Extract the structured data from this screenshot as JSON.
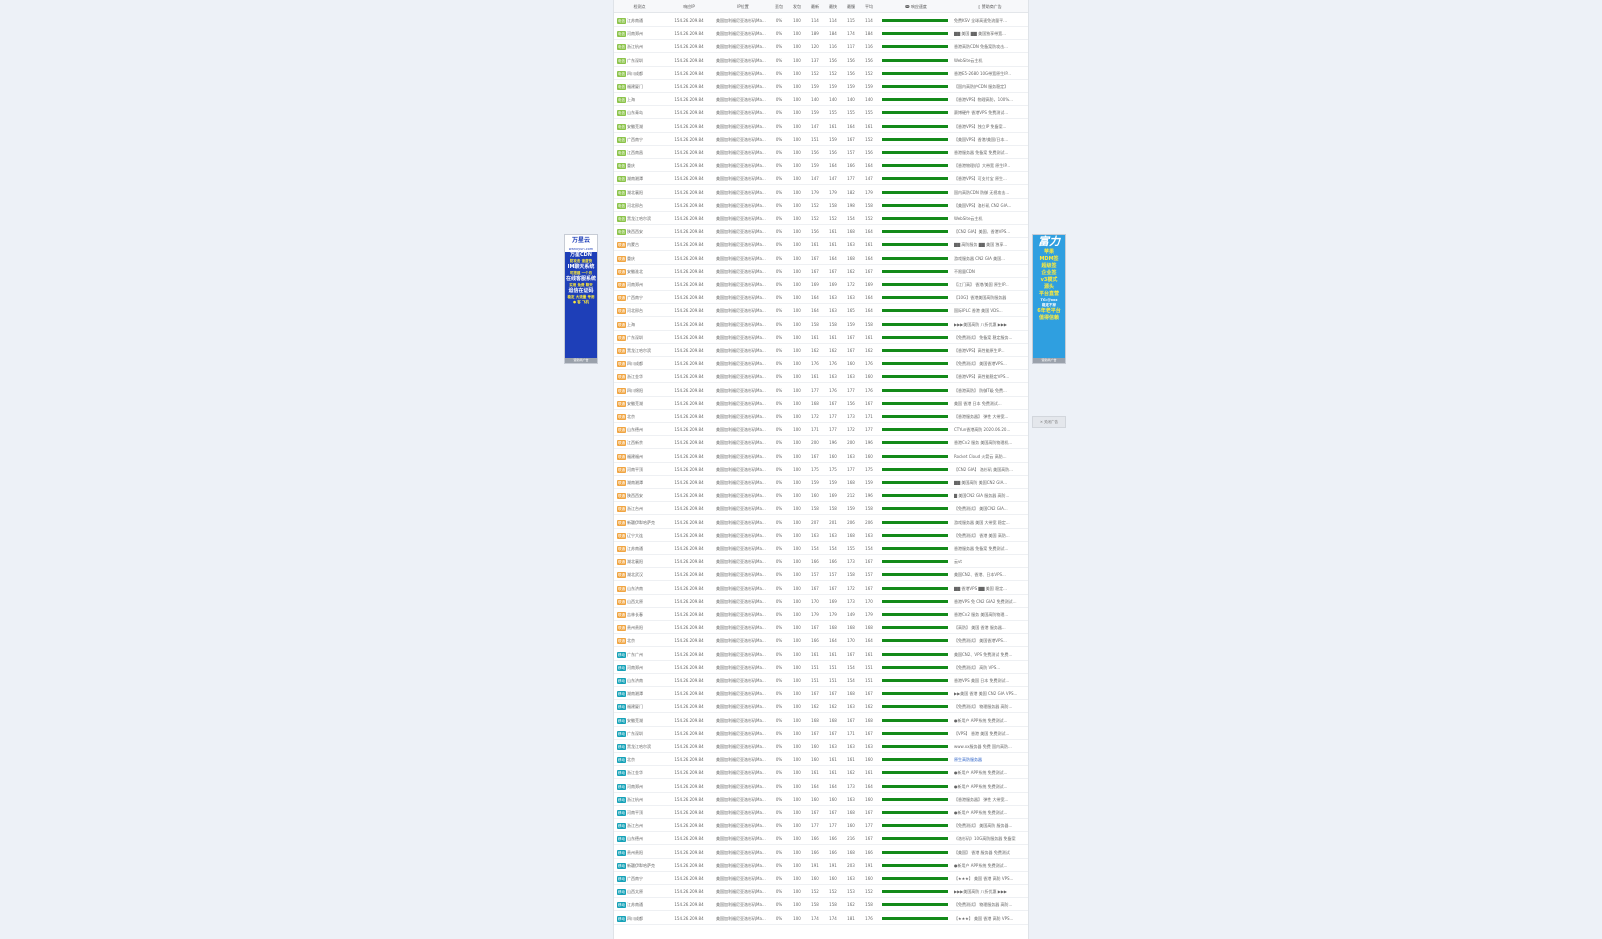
{
  "headers": {
    "node": "检测点",
    "ip": "响应IP",
    "pos": "IP位置",
    "loss": "丢包",
    "sent": "发包",
    "last": "最新",
    "min": "最快",
    "max": "最慢",
    "avg": "平均",
    "chart": "ↈ 响应速度",
    "ad": "▯ 赞助商广告"
  },
  "ip_value": "154.26.209.84",
  "pos_value": "美国加利福尼亚洛杉矶Ma...",
  "loss_value": "0%",
  "sent_value": "100",
  "badges": {
    "dx": "电信",
    "lt": "联通",
    "yd": "移动"
  },
  "badge_colors": {
    "dx": "#8bc34a",
    "lt": "#f0a542",
    "yd": "#17a2b8"
  },
  "rows": [
    {
      "isp": "dx",
      "node": "江苏南通",
      "last": "114",
      "min": "114",
      "max": "115",
      "avg": "114",
      "ad": "免费KSV 全球高速免流量平..."
    },
    {
      "isp": "dx",
      "node": "河南郑州",
      "last": "189",
      "min": "184",
      "max": "174",
      "avg": "184",
      "ad": "▇▇ 美国 ▇▇ 美国独享带宽..."
    },
    {
      "isp": "dx",
      "node": "浙江杭州",
      "last": "120",
      "min": "116",
      "max": "117",
      "avg": "116",
      "ad": "香港高防CDN 免备案防攻击..."
    },
    {
      "isp": "dx",
      "node": "广东深圳",
      "last": "137",
      "min": "156",
      "max": "156",
      "avg": "156",
      "ad": "WebSite云主机"
    },
    {
      "isp": "dx",
      "node": "四川成都",
      "last": "152",
      "min": "152",
      "max": "156",
      "avg": "152",
      "ad": "香港E5-2680 10G带宽原生IP..."
    },
    {
      "isp": "dx",
      "node": "福建厦门",
      "last": "159",
      "min": "159",
      "max": "159",
      "avg": "159",
      "ad": "【国内高防护CDN 服务稳定】"
    },
    {
      "isp": "dx",
      "node": "上海",
      "last": "140",
      "min": "140",
      "max": "140",
      "avg": "140",
      "ad": "【香港VPS】物理高防，100%..."
    },
    {
      "isp": "dx",
      "node": "山东青岛",
      "last": "159",
      "min": "155",
      "max": "155",
      "avg": "155",
      "ad": "赛博硬件 香港VPS 免费测试..."
    },
    {
      "isp": "dx",
      "node": "安徽芜湖",
      "last": "147",
      "min": "161",
      "max": "164",
      "avg": "161",
      "ad": "【香港VPS】独立IP 免备案..."
    },
    {
      "isp": "dx",
      "node": "广西南宁",
      "last": "151",
      "min": "159",
      "max": "167",
      "avg": "152",
      "ad": "【美国VPS】香港/美国/日本..."
    },
    {
      "isp": "dx",
      "node": "江西南昌",
      "last": "156",
      "min": "156",
      "max": "157",
      "avg": "156",
      "ad": "香港服务器 免备案 免费测试..."
    },
    {
      "isp": "dx",
      "node": "重庆",
      "last": "159",
      "min": "164",
      "max": "166",
      "avg": "164",
      "ad": "【香港物理机】大带宽 原生IP..."
    },
    {
      "isp": "dx",
      "node": "湖南湘潭",
      "last": "147",
      "min": "147",
      "max": "177",
      "avg": "147",
      "ad": "【香港VPS】可支付宝 原生..."
    },
    {
      "isp": "dx",
      "node": "湖北襄阳",
      "last": "179",
      "min": "179",
      "max": "182",
      "avg": "179",
      "ad": "国内高防CDN 防御 无视攻击..."
    },
    {
      "isp": "dx",
      "node": "河北邢台",
      "last": "152",
      "min": "158",
      "max": "198",
      "avg": "158",
      "ad": "【美国VPS】洛杉矶 CN2 GIA..."
    },
    {
      "isp": "dx",
      "node": "黑龙江哈尔滨",
      "last": "152",
      "min": "152",
      "max": "154",
      "avg": "152",
      "ad": "WebSite云主机"
    },
    {
      "isp": "dx",
      "node": "陕西西安",
      "last": "156",
      "min": "161",
      "max": "168",
      "avg": "164",
      "ad": "【CN2 GIA】美国、香港VPS..."
    },
    {
      "isp": "lt",
      "node": "内蒙古",
      "last": "161",
      "min": "161",
      "max": "163",
      "avg": "161",
      "ad": "▇▇ 高防服务 ▇▇ 美国 独享..."
    },
    {
      "isp": "lt",
      "node": "重庆",
      "last": "167",
      "min": "164",
      "max": "168",
      "avg": "164",
      "ad": "游戏服务器 CN2 GIA 美国..."
    },
    {
      "isp": "lt",
      "node": "安徽淮北",
      "last": "167",
      "min": "167",
      "max": "162",
      "avg": "167",
      "ad": "不限量CDN"
    },
    {
      "isp": "lt",
      "node": "河南郑州",
      "last": "169",
      "min": "169",
      "max": "172",
      "avg": "169",
      "ad": "【江门高】 香港/美国 原生IP..."
    },
    {
      "isp": "lt",
      "node": "广西南宁",
      "last": "164",
      "min": "163",
      "max": "163",
      "avg": "164",
      "ad": "【10G】香港美国高防服务器"
    },
    {
      "isp": "lt",
      "node": "河北邢台",
      "last": "164",
      "min": "163",
      "max": "165",
      "avg": "164",
      "ad": "国际IPLC 香港 美国 VDS..."
    },
    {
      "isp": "lt",
      "node": "上海",
      "last": "158",
      "min": "158",
      "max": "159",
      "avg": "158",
      "ad": "▶▶▶美国高防 八折优惠 ▶▶▶"
    },
    {
      "isp": "lt",
      "node": "广东深圳",
      "last": "161",
      "min": "161",
      "max": "167",
      "avg": "161",
      "ad": "【免费测试】 免备案 稳定服务..."
    },
    {
      "isp": "lt",
      "node": "黑龙江哈尔滨",
      "last": "162",
      "min": "162",
      "max": "167",
      "avg": "162",
      "ad": "【香港VPS】高性能原生IP..."
    },
    {
      "isp": "lt",
      "node": "四川成都",
      "last": "176",
      "min": "176",
      "max": "160",
      "avg": "176",
      "ad": "【免费测试】 美国香港VPS..."
    },
    {
      "isp": "lt",
      "node": "浙江金华",
      "last": "161",
      "min": "163",
      "max": "163",
      "avg": "160",
      "ad": "【香港VPS】高性能稳定VPS..."
    },
    {
      "isp": "lt",
      "node": "四川绵阳",
      "last": "177",
      "min": "176",
      "max": "177",
      "avg": "176",
      "ad": "【香港高防】 防御T级 免费..."
    },
    {
      "isp": "lt",
      "node": "安徽芜湖",
      "last": "168",
      "min": "167",
      "max": "156",
      "avg": "167",
      "ad": "美国 香港 日本 免费测试..."
    },
    {
      "isp": "lt",
      "node": "北京",
      "last": "172",
      "min": "177",
      "max": "173",
      "avg": "171",
      "ad": "【香港服务器】 弹性 大带宽..."
    },
    {
      "isp": "lt",
      "node": "山东德州",
      "last": "171",
      "min": "177",
      "max": "172",
      "avg": "177",
      "ad": "CTYun香港高防 2020.06.20..."
    },
    {
      "isp": "lt",
      "node": "江西新余",
      "last": "200",
      "min": "196",
      "max": "200",
      "avg": "196",
      "ad": "香港Cn2 服务 美国高防物理机..."
    },
    {
      "isp": "lt",
      "node": "福建福州",
      "last": "167",
      "min": "160",
      "max": "163",
      "avg": "160",
      "ad": "Rocket Cloud 火箭云 高防..."
    },
    {
      "isp": "lt",
      "node": "河南平顶",
      "last": "175",
      "min": "175",
      "max": "177",
      "avg": "175",
      "ad": "【CN2 GIA】 洛杉矶 美国高防..."
    },
    {
      "isp": "lt",
      "node": "湖南湘潭",
      "last": "159",
      "min": "159",
      "max": "168",
      "avg": "159",
      "ad": "▇▇ 美国高防 美国CN2 GIA..."
    },
    {
      "isp": "lt",
      "node": "陕西西安",
      "last": "160",
      "min": "169",
      "max": "212",
      "avg": "196",
      "ad": "▇ 美国CN2 GIA 服务器 高防..."
    },
    {
      "isp": "lt",
      "node": "浙江台州",
      "last": "158",
      "min": "158",
      "max": "159",
      "avg": "158",
      "ad": "【免费测试】 美国CN2 GIA..."
    },
    {
      "isp": "lt",
      "node": "新疆伊犁哈萨克",
      "last": "207",
      "min": "201",
      "max": "206",
      "avg": "206",
      "ad": "游戏服务器 美国 大带宽 稳定..."
    },
    {
      "isp": "lt",
      "node": "辽宁大连",
      "last": "163",
      "min": "163",
      "max": "168",
      "avg": "163",
      "ad": "【免费测试】 香港 美国 高防..."
    },
    {
      "isp": "lt",
      "node": "江苏南通",
      "last": "154",
      "min": "154",
      "max": "155",
      "avg": "154",
      "ad": "香港服务器 免备案 免费测试..."
    },
    {
      "isp": "lt",
      "node": "湖北襄阳",
      "last": "166",
      "min": "166",
      "max": "173",
      "avg": "167",
      "ad": "云vt"
    },
    {
      "isp": "lt",
      "node": "湖北武汉",
      "last": "157",
      "min": "157",
      "max": "158",
      "avg": "157",
      "ad": "美国CN2、香港、日本VPS..."
    },
    {
      "isp": "lt",
      "node": "山东济南",
      "last": "167",
      "min": "167",
      "max": "172",
      "avg": "167",
      "ad": "▇▇ 香港VPS ▇▇ 美国 稳定..."
    },
    {
      "isp": "lt",
      "node": "山西太原",
      "last": "170",
      "min": "169",
      "max": "173",
      "avg": "170",
      "ad": "香港VPS 免 CN2 GIA2 免费测试..."
    },
    {
      "isp": "lt",
      "node": "吉林长春",
      "last": "179",
      "min": "179",
      "max": "149",
      "avg": "179",
      "ad": "香港Cn2 服务 美国高防物理..."
    },
    {
      "isp": "lt",
      "node": "贵州贵阳",
      "last": "167",
      "min": "168",
      "max": "168",
      "avg": "168",
      "ad": "【高防】 美国 香港 服务器..."
    },
    {
      "isp": "lt",
      "node": "北京",
      "last": "166",
      "min": "164",
      "max": "170",
      "avg": "164",
      "ad": "【免费测试】 美国香港VPS..."
    },
    {
      "isp": "yd",
      "node": "广东广州",
      "last": "161",
      "min": "161",
      "max": "167",
      "avg": "161",
      "ad": "美国CN2、VPS 免费测试 免费..."
    },
    {
      "isp": "yd",
      "node": "河南郑州",
      "last": "151",
      "min": "151",
      "max": "154",
      "avg": "151",
      "ad": "【免费测试】 高防 VPS..."
    },
    {
      "isp": "yd",
      "node": "山东济南",
      "last": "151",
      "min": "151",
      "max": "154",
      "avg": "151",
      "ad": "香港VPS 美国 日本 免费测试..."
    },
    {
      "isp": "yd",
      "node": "湖南湘潭",
      "last": "167",
      "min": "167",
      "max": "168",
      "avg": "167",
      "ad": "▶▶美国 香港 美国 CN2 GIA VPS..."
    },
    {
      "isp": "yd",
      "node": "福建厦门",
      "last": "162",
      "min": "162",
      "max": "163",
      "avg": "162",
      "ad": "【免费测试】 物理服务器 高防..."
    },
    {
      "isp": "yd",
      "node": "安徽芜湖",
      "last": "168",
      "min": "168",
      "max": "167",
      "avg": "168",
      "ad": "●新用户 APP系统 免费测试..."
    },
    {
      "isp": "yd",
      "node": "广东深圳",
      "last": "167",
      "min": "167",
      "max": "171",
      "avg": "167",
      "ad": "【VPS】 香港 美国 免费测试..."
    },
    {
      "isp": "yd",
      "node": "黑龙江哈尔滨",
      "last": "160",
      "min": "163",
      "max": "163",
      "avg": "163",
      "ad": "www.xx服务器 免费 国内高防..."
    },
    {
      "isp": "yd",
      "node": "北京",
      "last": "160",
      "min": "161",
      "max": "161",
      "avg": "160",
      "ad": "原生高防服务器",
      "link": true
    },
    {
      "isp": "yd",
      "node": "浙江金华",
      "last": "161",
      "min": "161",
      "max": "162",
      "avg": "161",
      "ad": "●新用户 APP系统 免费测试..."
    },
    {
      "isp": "yd",
      "node": "河南郑州",
      "last": "164",
      "min": "164",
      "max": "173",
      "avg": "164",
      "ad": "●新用户 APP系统 免费测试..."
    },
    {
      "isp": "yd",
      "node": "浙江杭州",
      "last": "160",
      "min": "160",
      "max": "163",
      "avg": "160",
      "ad": "【香港服务器】 弹性 大带宽..."
    },
    {
      "isp": "yd",
      "node": "河南平顶",
      "last": "167",
      "min": "167",
      "max": "168",
      "avg": "167",
      "ad": "●新用户 APP系统 免费测试..."
    },
    {
      "isp": "yd",
      "node": "浙江台州",
      "last": "177",
      "min": "177",
      "max": "160",
      "avg": "177",
      "ad": "【免费测试】 美国高防 服务器..."
    },
    {
      "isp": "yd",
      "node": "山东德州",
      "last": "166",
      "min": "166",
      "max": "216",
      "avg": "167",
      "ad": "《洛杉矶》10G高防服务器 免备案"
    },
    {
      "isp": "yd",
      "node": "贵州贵阳",
      "last": "166",
      "min": "166",
      "max": "168",
      "avg": "166",
      "ad": "【美国】 香港 服务器 免费测试"
    },
    {
      "isp": "yd",
      "node": "新疆伊犁哈萨克",
      "last": "191",
      "min": "191",
      "max": "203",
      "avg": "191",
      "ad": "●新用户 APP系统 免费测试..."
    },
    {
      "isp": "yd",
      "node": "广西南宁",
      "last": "160",
      "min": "160",
      "max": "163",
      "avg": "160",
      "ad": "【★★★】 美国 香港 高防 VPS..."
    },
    {
      "isp": "yd",
      "node": "山西太原",
      "last": "152",
      "min": "152",
      "max": "153",
      "avg": "152",
      "ad": "▶▶▶美国高防 八折优惠 ▶▶▶"
    },
    {
      "isp": "yd",
      "node": "江苏南通",
      "last": "158",
      "min": "158",
      "max": "162",
      "avg": "158",
      "ad": "【免费测试】 物理服务器 高防..."
    },
    {
      "isp": "yd",
      "node": "四川成都",
      "last": "174",
      "min": "174",
      "max": "181",
      "avg": "176",
      "ad": "【★★★】 美国 香港 高防 VPS..."
    }
  ],
  "left_ad": {
    "logo": "万星云",
    "site": "wanxyun.com",
    "lines": [
      "万星CDN",
      "防攻击 速度快",
      "IM聊天系统",
      "可搭建 一个月",
      "在线客服系统",
      "实用 免费 聊天",
      "追信在证码",
      "稳定 大流量 专用"
    ],
    "footer": "● 客 飞机",
    "label": "赞助商广告"
  },
  "right_ad": {
    "title": "富力",
    "lines": [
      "苹果",
      "MDM签",
      "超级签",
      "企业签",
      "v3模式",
      "源头",
      "平台直营",
      "TG:@xxx",
      "稳定不掉",
      "6年老平台",
      "值得信赖"
    ],
    "label": "赞助商广告"
  },
  "close_ads": "✕ 关闭广告"
}
